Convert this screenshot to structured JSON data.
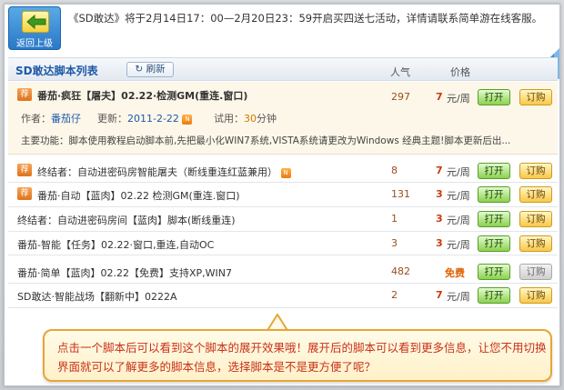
{
  "back": {
    "label": "返回上级"
  },
  "notice": "《SD敢达》将于2月14日17：00—2月20日23：59开启买四送七活动，详情请联系简单游在线客服。",
  "header": {
    "title": "SD敢达脚本列表",
    "refresh": "刷新",
    "col_popularity": "人气",
    "col_price": "价格"
  },
  "featured": {
    "badge": "荐",
    "title": "番茄·疯狂【屠夫】02.22·检测GM(重连.窗口)",
    "author_label": "作者：",
    "author": "番茄仔",
    "updated_label": "更新：",
    "updated": "2011-2-22",
    "trial_label": "试用：",
    "trial_value": "30",
    "trial_unit": "分钟",
    "description": "主要功能：脚本使用教程启动脚本前,先把最小化WIN7系统,VISTA系统请更改为Windows 经典主题!脚本更新后出...",
    "popularity": "297",
    "price": "7",
    "unit": "元/周",
    "open": "打开",
    "buy": "订购"
  },
  "rows": [
    {
      "badge": "荐",
      "title": "终结者：自动进密码房智能屠夫（断线重连红蓝兼用）",
      "new_icon": true,
      "popularity": "8",
      "price": "7",
      "unit": "元/周",
      "open": "打开",
      "buy": "订购"
    },
    {
      "badge": "荐",
      "title": "番茄·自动【蓝肉】02.22 检测GM(重连.窗口)",
      "new_icon": false,
      "popularity": "131",
      "price": "3",
      "unit": "元/周",
      "open": "打开",
      "buy": "订购"
    },
    {
      "badge": "",
      "title": "终结者：自动进密码房间【蓝肉】脚本(断线重连)",
      "new_icon": false,
      "popularity": "1",
      "price": "3",
      "unit": "元/周",
      "open": "打开",
      "buy": "订购"
    },
    {
      "badge": "",
      "title": "番茄-智能【任务】02.22·窗口,重连,自动OC",
      "new_icon": false,
      "popularity": "3",
      "price": "3",
      "unit": "元/周",
      "open": "打开",
      "buy": "订购"
    },
    {
      "badge": "",
      "title": "番茄·简单【蓝肉】02.22【免费】支持XP,WIN7",
      "new_icon": false,
      "popularity": "482",
      "price": "",
      "free": "免费",
      "unit": "",
      "open": "打开",
      "buy": "订购",
      "buy_disabled": true
    },
    {
      "badge": "",
      "title": "SD敢达·智能战场【翻新中】0222A",
      "new_icon": false,
      "popularity": "2",
      "price": "7",
      "unit": "元/周",
      "open": "打开",
      "buy": "订购"
    }
  ],
  "new_icon_label": "N",
  "callout": {
    "text": "点击一个脚本后可以看到这个脚本的展开效果哦！展开后的脚本可以看到更多信息，让您不用切换界面就可以了解更多的脚本信息，选择脚本是不是更方便了呢？"
  },
  "colors": {
    "accent_blue": "#1e5aa8",
    "price_red": "#c83a10",
    "callout_text": "#c8321a",
    "callout_border": "#e7a537"
  }
}
